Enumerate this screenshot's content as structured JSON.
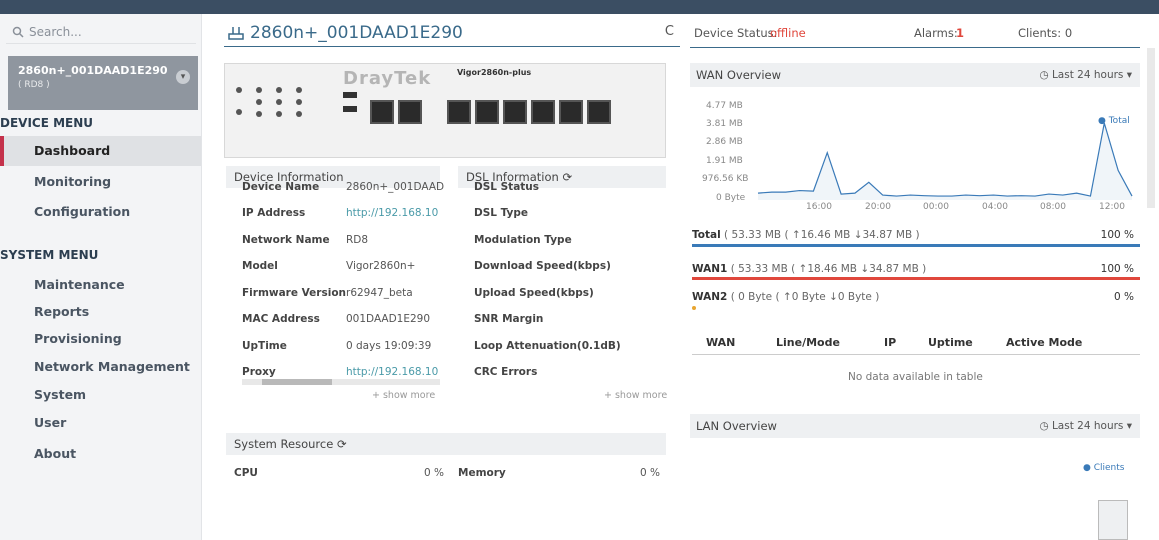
{
  "search": {
    "placeholder": "Search..."
  },
  "device_card": {
    "name": "2860n+_001DAAD1E290",
    "sub": "( RD8 )"
  },
  "menus": {
    "device_title": "DEVICE MENU",
    "device_items": [
      "Dashboard",
      "Monitoring",
      "Configuration"
    ],
    "system_title": "SYSTEM MENU",
    "system_items": [
      "Maintenance",
      "Reports",
      "Provisioning",
      "Network Management",
      "System",
      "User",
      "About"
    ]
  },
  "header": {
    "title": "2860n+_001DAAD1E290",
    "refresh": "C"
  },
  "status": {
    "device_label": "Device Status:",
    "device_value": "offline",
    "alarms_label": "Alarms:",
    "alarms_value": "1",
    "clients": "Clients: 0"
  },
  "panel": {
    "brand": "DrayTek",
    "model": "Vigor2860n-plus"
  },
  "device_info": {
    "title": "Device Information",
    "rows": [
      {
        "label": "Device Name",
        "value": "2860n+_001DAAD"
      },
      {
        "label": "IP Address",
        "value": "http://192.168.10"
      },
      {
        "label": "Network Name",
        "value": "RD8"
      },
      {
        "label": "Model",
        "value": "Vigor2860n+"
      },
      {
        "label": "Firmware Version",
        "value": "r62947_beta"
      },
      {
        "label": "MAC Address",
        "value": "001DAAD1E290"
      },
      {
        "label": "UpTime",
        "value": "0 days 19:09:39"
      },
      {
        "label": "Proxy",
        "value": "http://192.168.10"
      }
    ],
    "show_more": "+ show more"
  },
  "dsl_info": {
    "title": "DSL Information",
    "rows": [
      "DSL Status",
      "DSL Type",
      "Modulation Type",
      "Download Speed(kbps)",
      "Upload Speed(kbps)",
      "SNR Margin",
      "Loop Attenuation(0.1dB)",
      "CRC Errors"
    ],
    "show_more": "+ show more"
  },
  "system_resource": {
    "title": "System Resource",
    "cpu": "CPU",
    "cpu_value": "0 %",
    "memory": "Memory",
    "memory_value": "0 %"
  },
  "wan_overview": {
    "title": "WAN Overview",
    "range": "Last 24 hours",
    "legend": "Total",
    "total_label": "Total",
    "total_value": "( 53.33 MB  ( ↑16.46 MB  ↓34.87 MB )",
    "total_pct": "100 %",
    "wan1_label": "WAN1",
    "wan1_value": "( 53.33 MB  ( ↑18.46 MB  ↓34.87 MB )",
    "wan1_pct": "100 %",
    "wan2_label": "WAN2",
    "wan2_value": "( 0 Byte  ( ↑0 Byte  ↓0 Byte )",
    "wan2_pct": "0 %",
    "total_color": "#3a7ab8",
    "wan1_color": "#e0473c",
    "wan2_color": "#e8a531"
  },
  "chart_data": {
    "type": "area",
    "y_ticks": [
      "4.77 MB",
      "3.81 MB",
      "2.86 MB",
      "1.91 MB",
      "976.56 KB",
      "0 Byte"
    ],
    "x_ticks": [
      "16:00",
      "20:00",
      "00:00",
      "04:00",
      "08:00",
      "12:00"
    ],
    "series": [
      {
        "name": "Total",
        "values": [
          0.35,
          0.4,
          0.4,
          0.48,
          0.45,
          2.4,
          0.3,
          0.35,
          0.9,
          0.25,
          0.2,
          0.25,
          0.22,
          0.2,
          0.2,
          0.25,
          0.22,
          0.25,
          0.2,
          0.22,
          0.2,
          0.3,
          0.25,
          0.35,
          0.2,
          3.9,
          1.5,
          0.2
        ]
      }
    ]
  },
  "wan_table": {
    "headers": [
      "WAN",
      "Line/Mode",
      "IP",
      "Uptime",
      "Active Mode"
    ],
    "empty": "No data available in table"
  },
  "lan_overview": {
    "title": "LAN Overview",
    "range": "Last 24 hours",
    "legend": "Clients"
  }
}
